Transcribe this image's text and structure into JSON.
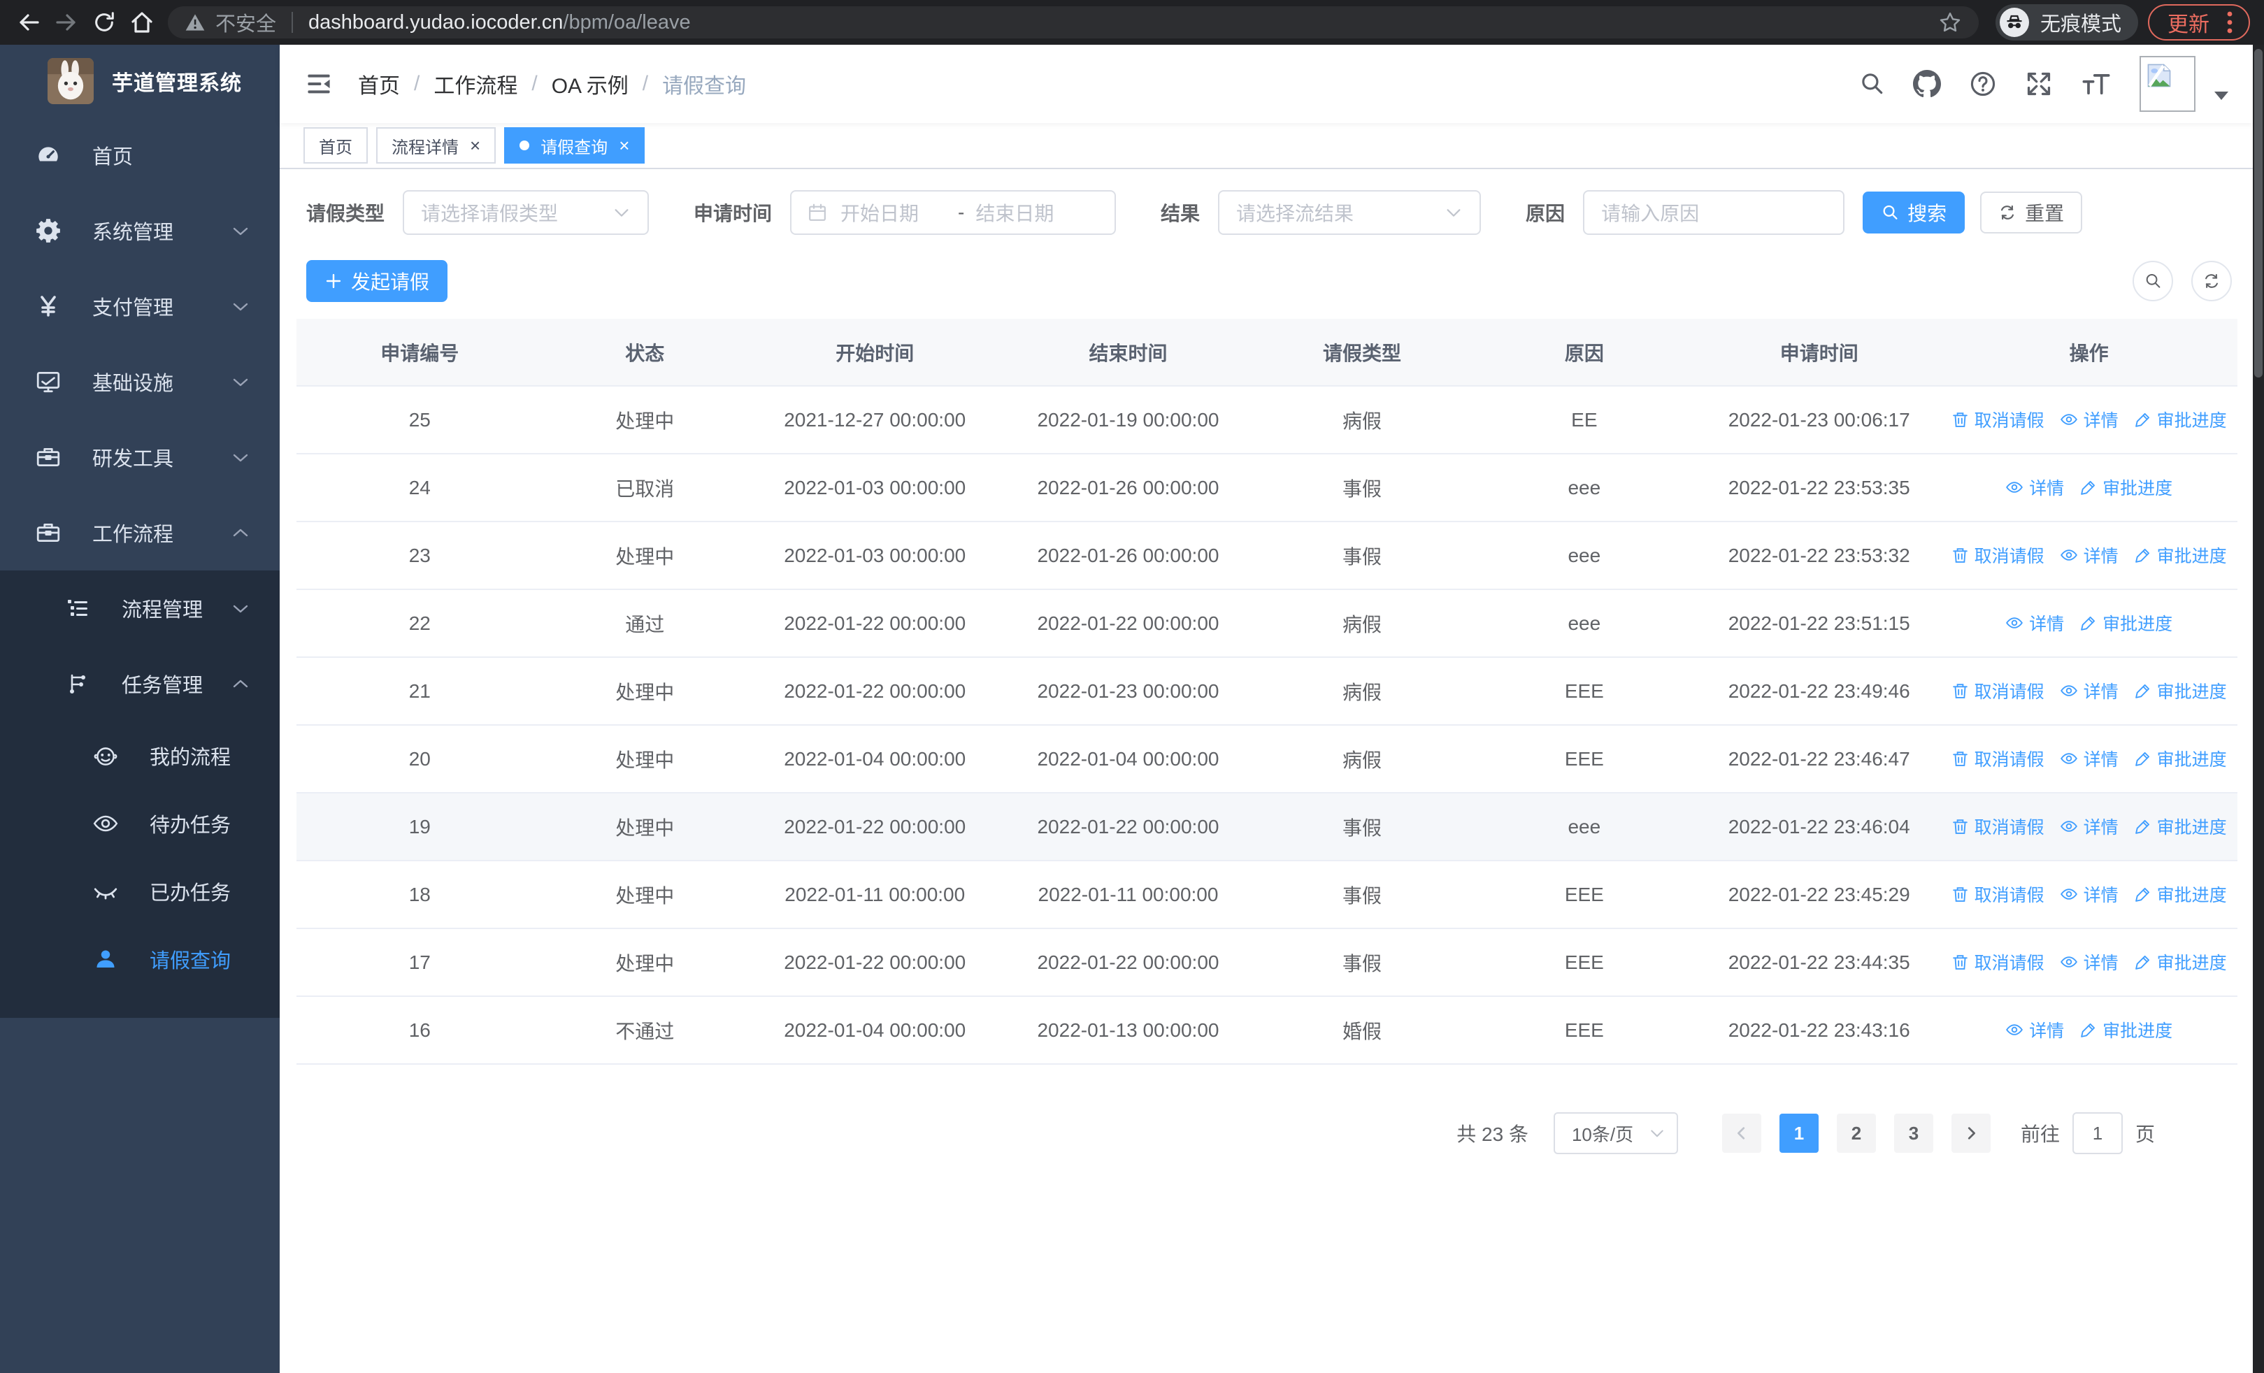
{
  "browser": {
    "security_label": "不安全",
    "url_host": "dashboard.yudao.iocoder.cn",
    "url_path": "/bpm/oa/leave",
    "incognito_label": "无痕模式",
    "update_label": "更新"
  },
  "sidebar": {
    "title": "芋道管理系统",
    "menu": [
      {
        "label": "首页",
        "icon": "dashboard-icon",
        "level": 1,
        "chevron": "",
        "sub": false,
        "active": false
      },
      {
        "label": "系统管理",
        "icon": "gear-icon",
        "level": 1,
        "chevron": "down",
        "sub": false,
        "active": false
      },
      {
        "label": "支付管理",
        "icon": "yen-icon",
        "level": 1,
        "chevron": "down",
        "sub": false,
        "active": false
      },
      {
        "label": "基础设施",
        "icon": "monitor-icon",
        "level": 1,
        "chevron": "down",
        "sub": false,
        "active": false
      },
      {
        "label": "研发工具",
        "icon": "toolbox-icon",
        "level": 1,
        "chevron": "down",
        "sub": false,
        "active": false
      },
      {
        "label": "工作流程",
        "icon": "toolbox-icon",
        "level": 1,
        "chevron": "up",
        "sub": false,
        "active": false
      },
      {
        "label": "流程管理",
        "icon": "tree-list-icon",
        "level": 2,
        "chevron": "down",
        "sub": true,
        "active": false
      },
      {
        "label": "任务管理",
        "icon": "flow-icon",
        "level": 2,
        "chevron": "up",
        "sub": true,
        "active": false
      },
      {
        "label": "我的流程",
        "icon": "robot-icon",
        "level": 3,
        "chevron": "",
        "sub": true,
        "active": false
      },
      {
        "label": "待办任务",
        "icon": "eye-icon",
        "level": 3,
        "chevron": "",
        "sub": true,
        "active": false
      },
      {
        "label": "已办任务",
        "icon": "eye-closed-icon",
        "level": 3,
        "chevron": "",
        "sub": true,
        "active": false
      },
      {
        "label": "请假查询",
        "icon": "user-icon",
        "level": 3,
        "chevron": "",
        "sub": true,
        "active": true
      }
    ]
  },
  "header": {
    "breadcrumb": [
      "首页",
      "工作流程",
      "OA 示例",
      "请假查询"
    ],
    "tabs": [
      {
        "label": "首页",
        "closable": false,
        "active": false
      },
      {
        "label": "流程详情",
        "closable": true,
        "active": false
      },
      {
        "label": "请假查询",
        "closable": true,
        "active": true
      }
    ]
  },
  "filters": {
    "type_label": "请假类型",
    "type_placeholder": "请选择请假类型",
    "time_label": "申请时间",
    "date_start_placeholder": "开始日期",
    "date_separator": "-",
    "date_end_placeholder": "结束日期",
    "result_label": "结果",
    "result_placeholder": "请选择流结果",
    "reason_label": "原因",
    "reason_placeholder": "请输入原因",
    "search_label": "搜索",
    "reset_label": "重置"
  },
  "toolbar": {
    "create_label": "发起请假"
  },
  "table": {
    "columns": [
      "申请编号",
      "状态",
      "开始时间",
      "结束时间",
      "请假类型",
      "原因",
      "申请时间",
      "操作"
    ],
    "action_labels": {
      "cancel": "取消请假",
      "detail": "详情",
      "progress": "审批进度"
    },
    "rows": [
      {
        "id": "25",
        "status": "处理中",
        "start": "2021-12-27 00:00:00",
        "end": "2022-01-19 00:00:00",
        "type": "病假",
        "reason": "EE",
        "applied": "2022-01-23 00:06:17",
        "actions": [
          "cancel",
          "detail",
          "progress"
        ],
        "highlight": false
      },
      {
        "id": "24",
        "status": "已取消",
        "start": "2022-01-03 00:00:00",
        "end": "2022-01-26 00:00:00",
        "type": "事假",
        "reason": "eee",
        "applied": "2022-01-22 23:53:35",
        "actions": [
          "detail",
          "progress"
        ],
        "highlight": false
      },
      {
        "id": "23",
        "status": "处理中",
        "start": "2022-01-03 00:00:00",
        "end": "2022-01-26 00:00:00",
        "type": "事假",
        "reason": "eee",
        "applied": "2022-01-22 23:53:32",
        "actions": [
          "cancel",
          "detail",
          "progress"
        ],
        "highlight": false
      },
      {
        "id": "22",
        "status": "通过",
        "start": "2022-01-22 00:00:00",
        "end": "2022-01-22 00:00:00",
        "type": "病假",
        "reason": "eee",
        "applied": "2022-01-22 23:51:15",
        "actions": [
          "detail",
          "progress"
        ],
        "highlight": false
      },
      {
        "id": "21",
        "status": "处理中",
        "start": "2022-01-22 00:00:00",
        "end": "2022-01-23 00:00:00",
        "type": "病假",
        "reason": "EEE",
        "applied": "2022-01-22 23:49:46",
        "actions": [
          "cancel",
          "detail",
          "progress"
        ],
        "highlight": false
      },
      {
        "id": "20",
        "status": "处理中",
        "start": "2022-01-04 00:00:00",
        "end": "2022-01-04 00:00:00",
        "type": "病假",
        "reason": "EEE",
        "applied": "2022-01-22 23:46:47",
        "actions": [
          "cancel",
          "detail",
          "progress"
        ],
        "highlight": false
      },
      {
        "id": "19",
        "status": "处理中",
        "start": "2022-01-22 00:00:00",
        "end": "2022-01-22 00:00:00",
        "type": "事假",
        "reason": "eee",
        "applied": "2022-01-22 23:46:04",
        "actions": [
          "cancel",
          "detail",
          "progress"
        ],
        "highlight": true
      },
      {
        "id": "18",
        "status": "处理中",
        "start": "2022-01-11 00:00:00",
        "end": "2022-01-11 00:00:00",
        "type": "事假",
        "reason": "EEE",
        "applied": "2022-01-22 23:45:29",
        "actions": [
          "cancel",
          "detail",
          "progress"
        ],
        "highlight": false
      },
      {
        "id": "17",
        "status": "处理中",
        "start": "2022-01-22 00:00:00",
        "end": "2022-01-22 00:00:00",
        "type": "事假",
        "reason": "EEE",
        "applied": "2022-01-22 23:44:35",
        "actions": [
          "cancel",
          "detail",
          "progress"
        ],
        "highlight": false
      },
      {
        "id": "16",
        "status": "不通过",
        "start": "2022-01-04 00:00:00",
        "end": "2022-01-13 00:00:00",
        "type": "婚假",
        "reason": "EEE",
        "applied": "2022-01-22 23:43:16",
        "actions": [
          "detail",
          "progress"
        ],
        "highlight": false
      }
    ]
  },
  "pagination": {
    "total": "共 23 条",
    "page_size": "10条/页",
    "pages": [
      "1",
      "2",
      "3"
    ],
    "active_page": "1",
    "goto_label": "前往",
    "goto_value": "1",
    "page_unit": "页"
  },
  "colors": {
    "primary": "#409EFF",
    "sidebar_bg": "#324157",
    "submenu_bg": "#222d3d",
    "chrome_bg": "#202124",
    "update_accent": "#ed6d60"
  }
}
